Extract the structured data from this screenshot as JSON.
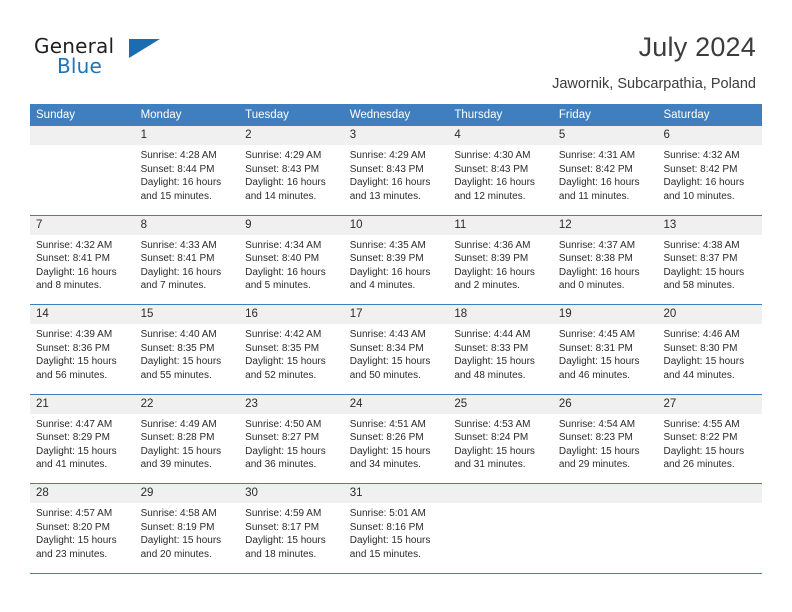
{
  "brand": {
    "name_top": "General",
    "name_bottom": "Blue",
    "triangle_icon": "blue-triangle-icon",
    "accent_color": "#1b75bb"
  },
  "header": {
    "title": "July 2024",
    "subtitle": "Jawornik, Subcarpathia, Poland"
  },
  "calendar": {
    "header_bg": "#3f7fbf",
    "daynum_bg": "#f0f0f0",
    "weekdays": [
      "Sunday",
      "Monday",
      "Tuesday",
      "Wednesday",
      "Thursday",
      "Friday",
      "Saturday"
    ],
    "weeks": [
      [
        {
          "day": "",
          "lines": []
        },
        {
          "day": "1",
          "lines": [
            "Sunrise: 4:28 AM",
            "Sunset: 8:44 PM",
            "Daylight: 16 hours",
            "and 15 minutes."
          ]
        },
        {
          "day": "2",
          "lines": [
            "Sunrise: 4:29 AM",
            "Sunset: 8:43 PM",
            "Daylight: 16 hours",
            "and 14 minutes."
          ]
        },
        {
          "day": "3",
          "lines": [
            "Sunrise: 4:29 AM",
            "Sunset: 8:43 PM",
            "Daylight: 16 hours",
            "and 13 minutes."
          ]
        },
        {
          "day": "4",
          "lines": [
            "Sunrise: 4:30 AM",
            "Sunset: 8:43 PM",
            "Daylight: 16 hours",
            "and 12 minutes."
          ]
        },
        {
          "day": "5",
          "lines": [
            "Sunrise: 4:31 AM",
            "Sunset: 8:42 PM",
            "Daylight: 16 hours",
            "and 11 minutes."
          ]
        },
        {
          "day": "6",
          "lines": [
            "Sunrise: 4:32 AM",
            "Sunset: 8:42 PM",
            "Daylight: 16 hours",
            "and 10 minutes."
          ]
        }
      ],
      [
        {
          "day": "7",
          "lines": [
            "Sunrise: 4:32 AM",
            "Sunset: 8:41 PM",
            "Daylight: 16 hours",
            "and 8 minutes."
          ]
        },
        {
          "day": "8",
          "lines": [
            "Sunrise: 4:33 AM",
            "Sunset: 8:41 PM",
            "Daylight: 16 hours",
            "and 7 minutes."
          ]
        },
        {
          "day": "9",
          "lines": [
            "Sunrise: 4:34 AM",
            "Sunset: 8:40 PM",
            "Daylight: 16 hours",
            "and 5 minutes."
          ]
        },
        {
          "day": "10",
          "lines": [
            "Sunrise: 4:35 AM",
            "Sunset: 8:39 PM",
            "Daylight: 16 hours",
            "and 4 minutes."
          ]
        },
        {
          "day": "11",
          "lines": [
            "Sunrise: 4:36 AM",
            "Sunset: 8:39 PM",
            "Daylight: 16 hours",
            "and 2 minutes."
          ]
        },
        {
          "day": "12",
          "lines": [
            "Sunrise: 4:37 AM",
            "Sunset: 8:38 PM",
            "Daylight: 16 hours",
            "and 0 minutes."
          ]
        },
        {
          "day": "13",
          "lines": [
            "Sunrise: 4:38 AM",
            "Sunset: 8:37 PM",
            "Daylight: 15 hours",
            "and 58 minutes."
          ]
        }
      ],
      [
        {
          "day": "14",
          "lines": [
            "Sunrise: 4:39 AM",
            "Sunset: 8:36 PM",
            "Daylight: 15 hours",
            "and 56 minutes."
          ]
        },
        {
          "day": "15",
          "lines": [
            "Sunrise: 4:40 AM",
            "Sunset: 8:35 PM",
            "Daylight: 15 hours",
            "and 55 minutes."
          ]
        },
        {
          "day": "16",
          "lines": [
            "Sunrise: 4:42 AM",
            "Sunset: 8:35 PM",
            "Daylight: 15 hours",
            "and 52 minutes."
          ]
        },
        {
          "day": "17",
          "lines": [
            "Sunrise: 4:43 AM",
            "Sunset: 8:34 PM",
            "Daylight: 15 hours",
            "and 50 minutes."
          ]
        },
        {
          "day": "18",
          "lines": [
            "Sunrise: 4:44 AM",
            "Sunset: 8:33 PM",
            "Daylight: 15 hours",
            "and 48 minutes."
          ]
        },
        {
          "day": "19",
          "lines": [
            "Sunrise: 4:45 AM",
            "Sunset: 8:31 PM",
            "Daylight: 15 hours",
            "and 46 minutes."
          ]
        },
        {
          "day": "20",
          "lines": [
            "Sunrise: 4:46 AM",
            "Sunset: 8:30 PM",
            "Daylight: 15 hours",
            "and 44 minutes."
          ]
        }
      ],
      [
        {
          "day": "21",
          "lines": [
            "Sunrise: 4:47 AM",
            "Sunset: 8:29 PM",
            "Daylight: 15 hours",
            "and 41 minutes."
          ]
        },
        {
          "day": "22",
          "lines": [
            "Sunrise: 4:49 AM",
            "Sunset: 8:28 PM",
            "Daylight: 15 hours",
            "and 39 minutes."
          ]
        },
        {
          "day": "23",
          "lines": [
            "Sunrise: 4:50 AM",
            "Sunset: 8:27 PM",
            "Daylight: 15 hours",
            "and 36 minutes."
          ]
        },
        {
          "day": "24",
          "lines": [
            "Sunrise: 4:51 AM",
            "Sunset: 8:26 PM",
            "Daylight: 15 hours",
            "and 34 minutes."
          ]
        },
        {
          "day": "25",
          "lines": [
            "Sunrise: 4:53 AM",
            "Sunset: 8:24 PM",
            "Daylight: 15 hours",
            "and 31 minutes."
          ]
        },
        {
          "day": "26",
          "lines": [
            "Sunrise: 4:54 AM",
            "Sunset: 8:23 PM",
            "Daylight: 15 hours",
            "and 29 minutes."
          ]
        },
        {
          "day": "27",
          "lines": [
            "Sunrise: 4:55 AM",
            "Sunset: 8:22 PM",
            "Daylight: 15 hours",
            "and 26 minutes."
          ]
        }
      ],
      [
        {
          "day": "28",
          "lines": [
            "Sunrise: 4:57 AM",
            "Sunset: 8:20 PM",
            "Daylight: 15 hours",
            "and 23 minutes."
          ]
        },
        {
          "day": "29",
          "lines": [
            "Sunrise: 4:58 AM",
            "Sunset: 8:19 PM",
            "Daylight: 15 hours",
            "and 20 minutes."
          ]
        },
        {
          "day": "30",
          "lines": [
            "Sunrise: 4:59 AM",
            "Sunset: 8:17 PM",
            "Daylight: 15 hours",
            "and 18 minutes."
          ]
        },
        {
          "day": "31",
          "lines": [
            "Sunrise: 5:01 AM",
            "Sunset: 8:16 PM",
            "Daylight: 15 hours",
            "and 15 minutes."
          ]
        },
        {
          "day": "",
          "lines": []
        },
        {
          "day": "",
          "lines": []
        },
        {
          "day": "",
          "lines": []
        }
      ]
    ]
  }
}
